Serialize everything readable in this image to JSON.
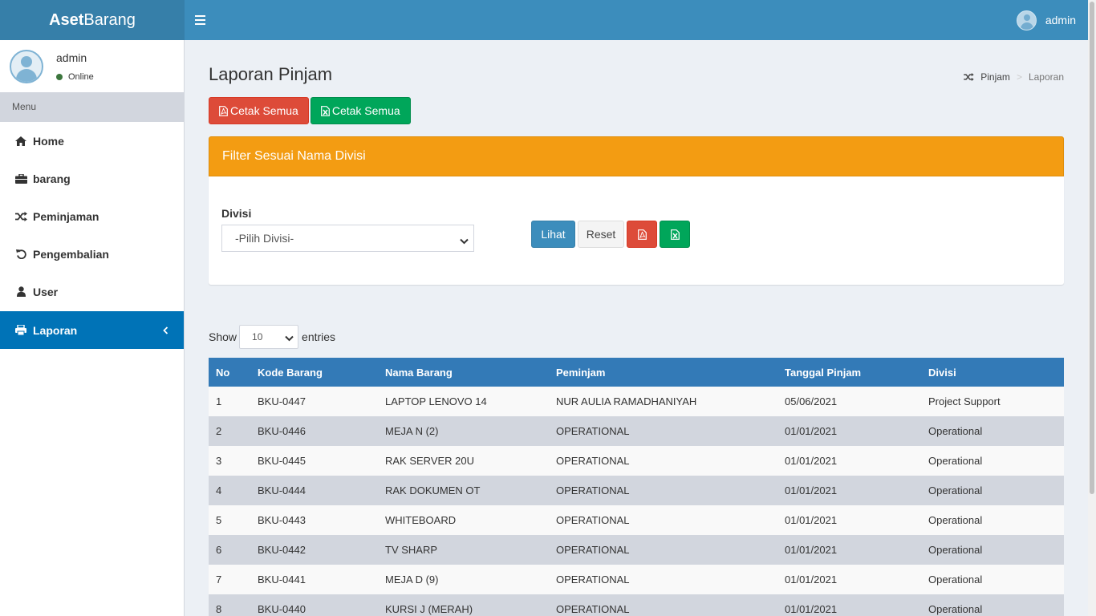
{
  "header": {
    "logo_bold": "Aset",
    "logo_rest": "Barang",
    "user": "admin"
  },
  "sidebar": {
    "user_name": "admin",
    "user_status": "Online",
    "menu_header": "Menu",
    "items": [
      {
        "label": "Home",
        "icon": "home-icon"
      },
      {
        "label": "barang",
        "icon": "briefcase-icon"
      },
      {
        "label": "Peminjaman",
        "icon": "random-icon"
      },
      {
        "label": "Pengembalian",
        "icon": "undo-icon"
      },
      {
        "label": "User",
        "icon": "user-icon"
      },
      {
        "label": "Laporan",
        "icon": "print-icon",
        "active": true
      }
    ]
  },
  "page": {
    "title": "Laporan Pinjam",
    "breadcrumb": [
      "Pinjam",
      "Laporan"
    ],
    "print_all_pdf": "Cetak Semua",
    "print_all_excel": "Cetak Semua"
  },
  "filter": {
    "title": "Filter Sesuai Nama Divisi",
    "label": "Divisi",
    "selected": "-Pilih Divisi-",
    "view_button": "Lihat",
    "reset_button": "Reset"
  },
  "table_controls": {
    "show_label": "Show",
    "length_value": "10",
    "entries_label": "entries"
  },
  "table": {
    "columns": [
      "No",
      "Kode Barang",
      "Nama Barang",
      "Peminjam",
      "Tanggal Pinjam",
      "Divisi"
    ],
    "rows": [
      [
        "1",
        "BKU-0447",
        "LAPTOP LENOVO 14",
        "NUR AULIA RAMADHANIYAH",
        "05/06/2021",
        "Project Support"
      ],
      [
        "2",
        "BKU-0446",
        "MEJA N (2)",
        "OPERATIONAL",
        "01/01/2021",
        "Operational"
      ],
      [
        "3",
        "BKU-0445",
        "RAK SERVER 20U",
        "OPERATIONAL",
        "01/01/2021",
        "Operational"
      ],
      [
        "4",
        "BKU-0444",
        "RAK DOKUMEN OT",
        "OPERATIONAL",
        "01/01/2021",
        "Operational"
      ],
      [
        "5",
        "BKU-0443",
        "WHITEBOARD",
        "OPERATIONAL",
        "01/01/2021",
        "Operational"
      ],
      [
        "6",
        "BKU-0442",
        "TV SHARP",
        "OPERATIONAL",
        "01/01/2021",
        "Operational"
      ],
      [
        "7",
        "BKU-0441",
        "MEJA D (9)",
        "OPERATIONAL",
        "01/01/2021",
        "Operational"
      ],
      [
        "8",
        "BKU-0440",
        "KURSI J (MERAH)",
        "OPERATIONAL",
        "01/01/2021",
        "Operational"
      ]
    ]
  }
}
